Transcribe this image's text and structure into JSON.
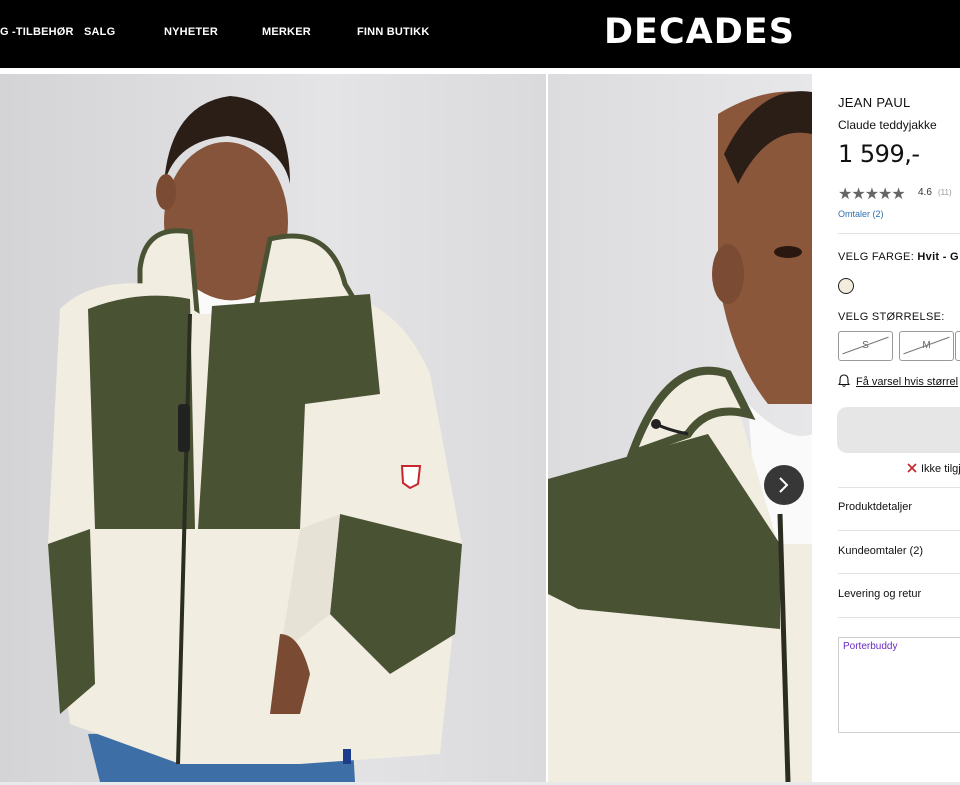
{
  "header": {
    "nav": [
      "G -TILBEHØR",
      "SALG",
      "NYHETER",
      "MERKER",
      "FINN BUTIKK"
    ],
    "logo": "DECADES"
  },
  "product": {
    "brand": "JEAN PAUL",
    "name": "Claude teddyjakke",
    "price": "1 599,-",
    "rating": {
      "value": 4.6,
      "stars_text": "★★★★★",
      "value_label": "4.6",
      "count_label": "(11)"
    },
    "reviews_link": "Omtaler (2)",
    "color": {
      "label": "VELG FARGE:",
      "selected": "Hvit - G",
      "swatch_color": "#f1ecdc"
    },
    "size": {
      "label": "VELG STØRRELSE:",
      "options": [
        "S",
        "M",
        ""
      ],
      "unavailable": true
    },
    "notify_text": "Få varsel hvis størrel",
    "add_to_cart": "",
    "availability": "Ikke tilgj"
  },
  "accordion": [
    "Produktdetaljer",
    "Kundeomtaler (2)",
    "Levering og retur"
  ],
  "porterbuddy": "Porterbuddy",
  "colors": {
    "jacket_fleece": "#f1ede1",
    "jacket_olive": "#4a5234",
    "link": "#2a6fb0",
    "error": "#c8262d"
  }
}
